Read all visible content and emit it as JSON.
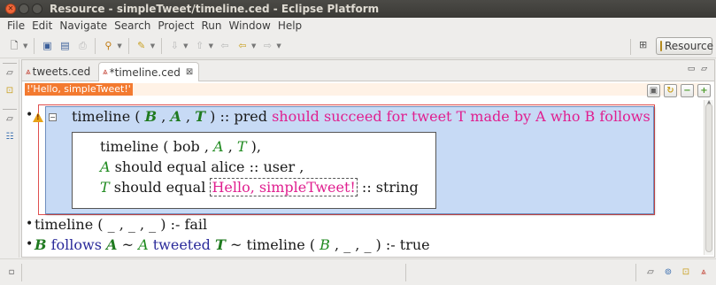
{
  "window": {
    "title": "Resource - simpleTweet/timeline.ced - Eclipse Platform"
  },
  "menu": [
    "File",
    "Edit",
    "Navigate",
    "Search",
    "Project",
    "Run",
    "Window",
    "Help"
  ],
  "perspective": {
    "label": "Resource"
  },
  "tabs": [
    {
      "label": "tweets.ced",
      "active": false
    },
    {
      "label": "*timeline.ced",
      "active": true,
      "close": "⊠"
    }
  ],
  "input_value": "!'Hello, simpleTweet!'",
  "colors": {
    "accent_orange": "#f37a30",
    "pink": "#e01f8f",
    "green": "#1f8a1f",
    "navy": "#2a2a9a",
    "selection_blue": "#c7daf5",
    "error_red": "#e05050"
  },
  "doc": {
    "rule1": {
      "head": {
        "fn": "timeline",
        "open": "(",
        "a1": "B",
        "c1": ",",
        "a2": "A",
        "c2": ",",
        "a3": "T",
        "close": ")",
        "sep": "::",
        "kind": "pred",
        "desc": "should succeed for tweet T made by A who B follows"
      },
      "body": {
        "l1": {
          "fn": "timeline",
          "open": "(",
          "a1": "bob",
          "c1": ",",
          "a2": "A",
          "c2": ",",
          "a3": "T",
          "close": ")",
          "end": ","
        },
        "l2": {
          "var": "A",
          "text": "should equal alice :: user ,"
        },
        "l3": {
          "var": "T",
          "text": "should equal",
          "value": "Hello, simpleTweet!",
          "suffix": ":: string"
        }
      }
    },
    "rule2": {
      "fn": "timeline",
      "args": "( _ , _ , _ )",
      "suffix": ":- fail"
    },
    "rule3": {
      "v1": "B",
      "follows": "follows",
      "v2": "A",
      "tilde1": "~",
      "v3": "A",
      "tweeted": "tweeted",
      "v4": "T",
      "tilde2": "~",
      "fn": "timeline",
      "open": "(",
      "a1": "B",
      "rest": ", _ , _ )",
      "suffix": ":- true"
    }
  }
}
